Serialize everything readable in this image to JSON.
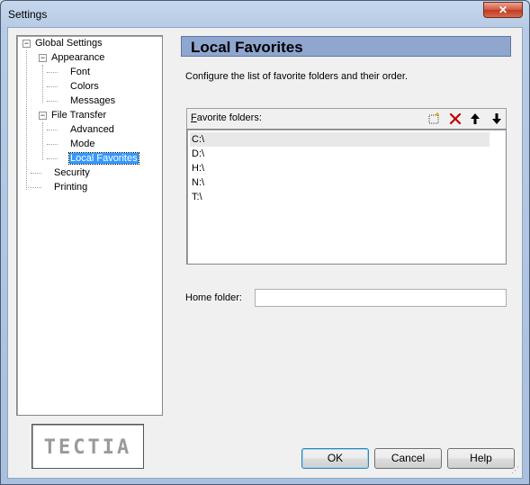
{
  "window": {
    "title": "Settings",
    "close_glyph": "✕"
  },
  "tree": {
    "items": [
      {
        "label": "Global Settings",
        "expander": "−"
      },
      {
        "label": "Appearance",
        "expander": "−"
      },
      {
        "label": "Font"
      },
      {
        "label": "Colors"
      },
      {
        "label": "Messages"
      },
      {
        "label": "File Transfer",
        "expander": "−"
      },
      {
        "label": "Advanced"
      },
      {
        "label": "Mode"
      },
      {
        "label": "Local Favorites",
        "selected": true
      },
      {
        "label": "Security"
      },
      {
        "label": "Printing"
      }
    ]
  },
  "logo": {
    "text": "TECTIA"
  },
  "page": {
    "title": "Local Favorites",
    "description": "Configure the list of favorite folders and their order.",
    "favorites_label": "Favorite folders:",
    "favorites_access_key": "F",
    "favorites_label_rest": "avorite folders:",
    "folders": [
      "C:\\",
      "D:\\",
      "H:\\",
      "N:\\",
      "T:\\"
    ],
    "home_folder_label": "Home folder:",
    "home_folder_value": ""
  },
  "toolbar": {
    "icons": [
      "new-folder-icon",
      "delete-icon",
      "move-up-icon",
      "move-down-icon"
    ],
    "delete_color": "#c00000"
  },
  "buttons": {
    "ok": "OK",
    "cancel": "Cancel",
    "help": "Help"
  }
}
